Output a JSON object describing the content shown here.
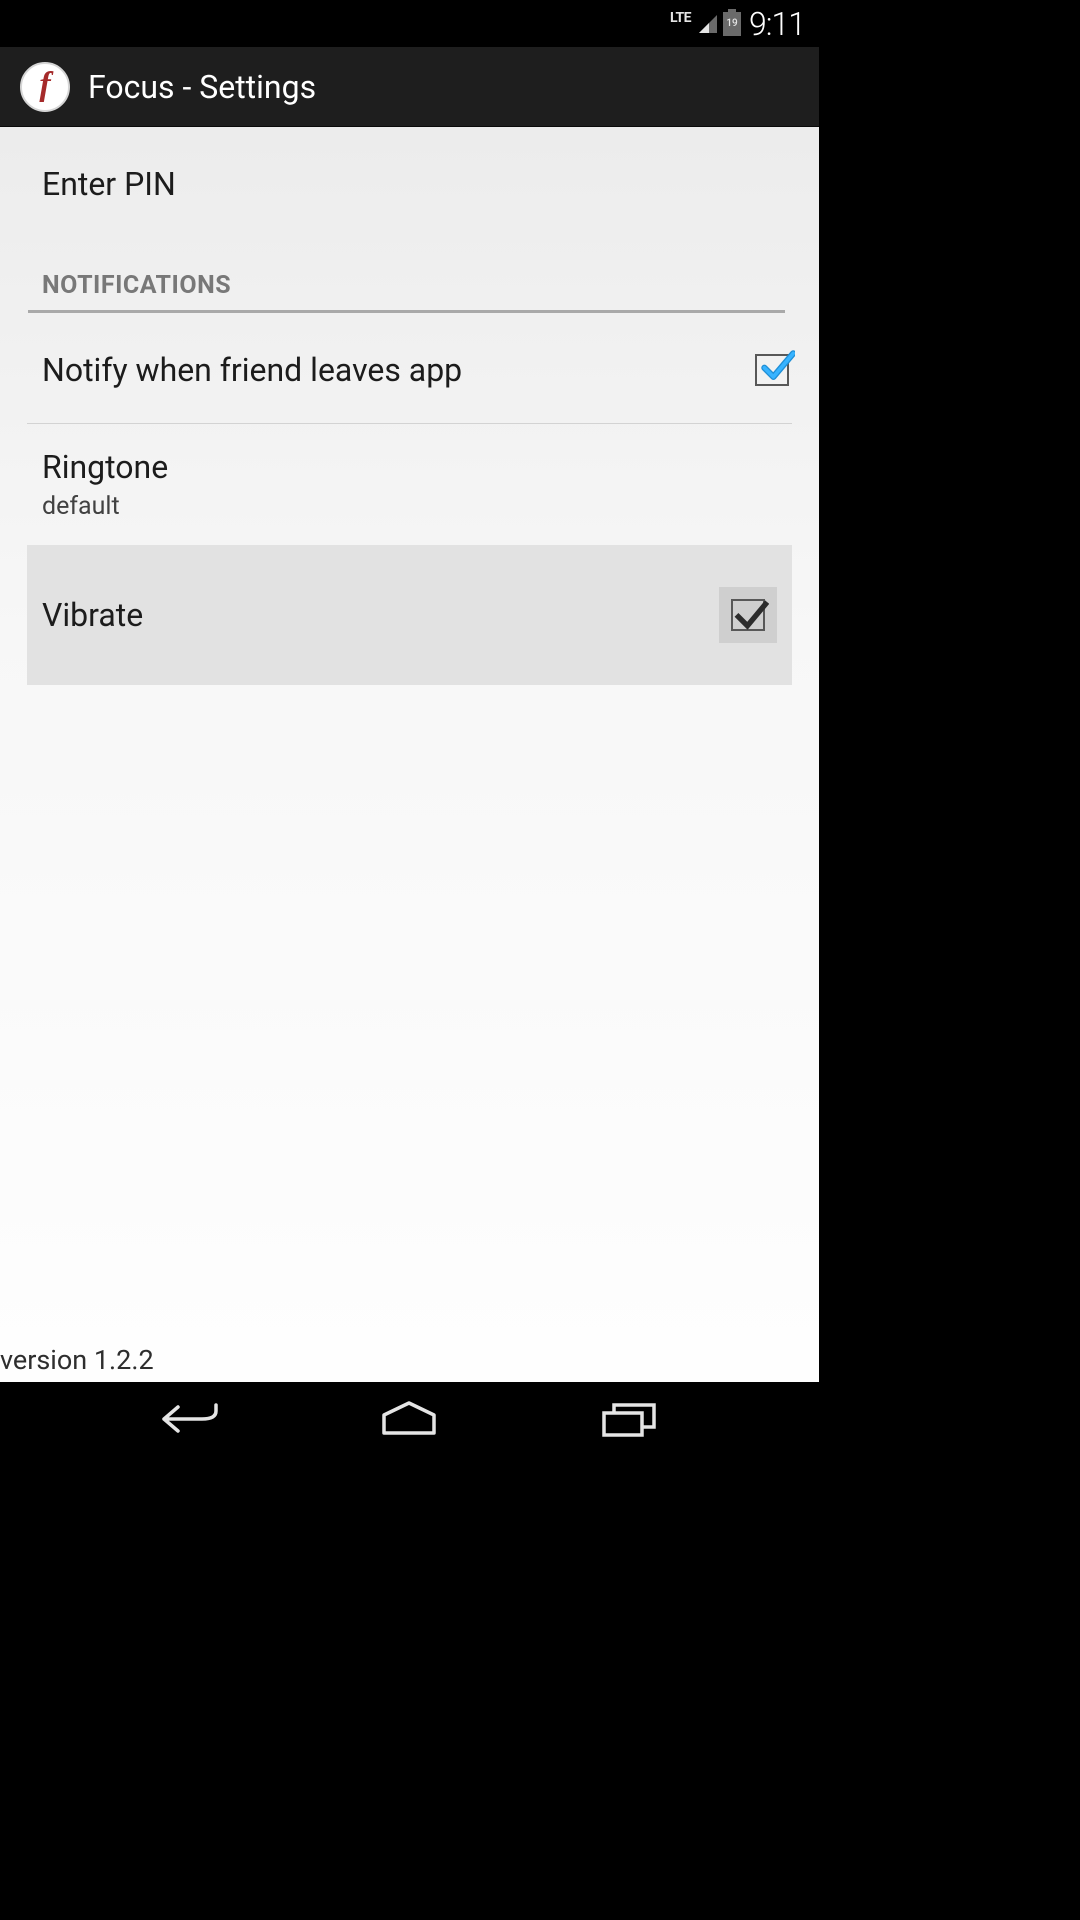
{
  "status": {
    "network": "LTE",
    "battery": "19",
    "time": "9:11"
  },
  "header": {
    "icon_letter": "f",
    "title": "Focus - Settings"
  },
  "items": {
    "enter_pin": {
      "label": "Enter PIN"
    },
    "section_notifications": {
      "title": "NOTIFICATIONS"
    },
    "notify_friend": {
      "label": "Notify when friend leaves app",
      "checked": true
    },
    "ringtone": {
      "label": "Ringtone",
      "value": "default"
    },
    "vibrate": {
      "label": "Vibrate",
      "checked": true
    }
  },
  "footer": {
    "version": "version 1.2.2"
  }
}
